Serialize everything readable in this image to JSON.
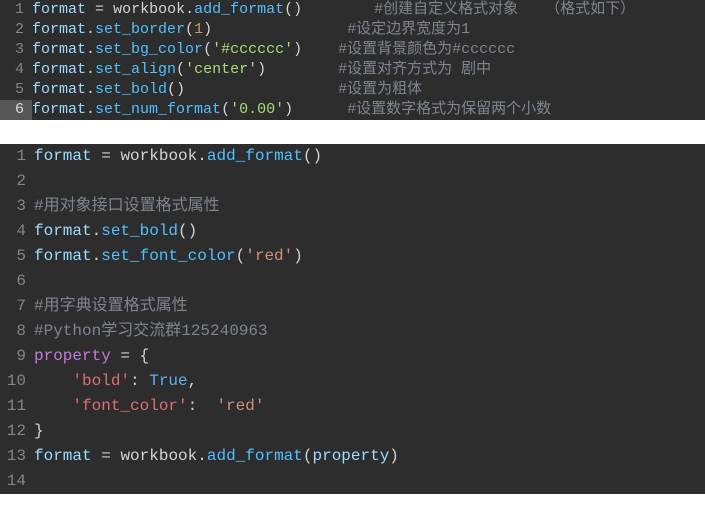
{
  "block1": {
    "lines": [
      {
        "num": "1",
        "tokens": [
          {
            "t": "format",
            "c": "tok-var"
          },
          {
            "t": " ",
            "c": ""
          },
          {
            "t": "=",
            "c": "tok-op"
          },
          {
            "t": " ",
            "c": ""
          },
          {
            "t": "workbook",
            "c": "tok-obj"
          },
          {
            "t": ".",
            "c": "tok-punct"
          },
          {
            "t": "add_format",
            "c": "tok-method"
          },
          {
            "t": "()",
            "c": "tok-punct"
          },
          {
            "t": "        ",
            "c": ""
          },
          {
            "t": "#创建自定义格式对象   （格式如下）",
            "c": "tok-comment"
          }
        ]
      },
      {
        "num": "2",
        "tokens": [
          {
            "t": "format",
            "c": "tok-var"
          },
          {
            "t": ".",
            "c": "tok-punct"
          },
          {
            "t": "set_border",
            "c": "tok-method"
          },
          {
            "t": "(",
            "c": "tok-punct"
          },
          {
            "t": "1",
            "c": "tok-num"
          },
          {
            "t": ")",
            "c": "tok-punct"
          },
          {
            "t": "               ",
            "c": ""
          },
          {
            "t": "#设定边界宽度为1",
            "c": "tok-comment"
          }
        ]
      },
      {
        "num": "3",
        "tokens": [
          {
            "t": "format",
            "c": "tok-var"
          },
          {
            "t": ".",
            "c": "tok-punct"
          },
          {
            "t": "set_bg_color",
            "c": "tok-method"
          },
          {
            "t": "(",
            "c": "tok-punct"
          },
          {
            "t": "'#cccccc'",
            "c": "tok-str2"
          },
          {
            "t": ")",
            "c": "tok-punct"
          },
          {
            "t": "    ",
            "c": ""
          },
          {
            "t": "#设置背景颜色为#cccccc",
            "c": "tok-comment"
          }
        ]
      },
      {
        "num": "4",
        "tokens": [
          {
            "t": "format",
            "c": "tok-var"
          },
          {
            "t": ".",
            "c": "tok-punct"
          },
          {
            "t": "set_align",
            "c": "tok-method"
          },
          {
            "t": "(",
            "c": "tok-punct"
          },
          {
            "t": "'center'",
            "c": "tok-str2"
          },
          {
            "t": ")",
            "c": "tok-punct"
          },
          {
            "t": "        ",
            "c": ""
          },
          {
            "t": "#设置对齐方式为 剧中",
            "c": "tok-comment"
          }
        ]
      },
      {
        "num": "5",
        "tokens": [
          {
            "t": "format",
            "c": "tok-var"
          },
          {
            "t": ".",
            "c": "tok-punct"
          },
          {
            "t": "set_bold",
            "c": "tok-method"
          },
          {
            "t": "()",
            "c": "tok-punct"
          },
          {
            "t": "                 ",
            "c": ""
          },
          {
            "t": "#设置为粗体",
            "c": "tok-comment"
          }
        ]
      },
      {
        "num": "6",
        "highlight": true,
        "tokens": [
          {
            "t": "format",
            "c": "tok-var"
          },
          {
            "t": ".",
            "c": "tok-punct"
          },
          {
            "t": "set_num_format",
            "c": "tok-method"
          },
          {
            "t": "(",
            "c": "tok-punct"
          },
          {
            "t": "'0.00'",
            "c": "tok-str2"
          },
          {
            "t": ")",
            "c": "tok-punct"
          },
          {
            "t": "      ",
            "c": ""
          },
          {
            "t": "#设置数字格式为保留两个小数",
            "c": "tok-comment"
          }
        ]
      }
    ]
  },
  "block2": {
    "lines": [
      {
        "num": "1",
        "tokens": [
          {
            "t": "format",
            "c": "tok-var"
          },
          {
            "t": " ",
            "c": ""
          },
          {
            "t": "=",
            "c": "tok-op"
          },
          {
            "t": " ",
            "c": ""
          },
          {
            "t": "workbook",
            "c": "tok-obj"
          },
          {
            "t": ".",
            "c": "tok-punct"
          },
          {
            "t": "add_format",
            "c": "tok-method"
          },
          {
            "t": "()",
            "c": "tok-punct"
          }
        ]
      },
      {
        "num": "2",
        "tokens": []
      },
      {
        "num": "3",
        "tokens": [
          {
            "t": "#用对象接口设置格式属性",
            "c": "tok-comment"
          }
        ]
      },
      {
        "num": "4",
        "tokens": [
          {
            "t": "format",
            "c": "tok-var"
          },
          {
            "t": ".",
            "c": "tok-punct"
          },
          {
            "t": "set_bold",
            "c": "tok-method"
          },
          {
            "t": "()",
            "c": "tok-punct"
          }
        ]
      },
      {
        "num": "5",
        "tokens": [
          {
            "t": "format",
            "c": "tok-var"
          },
          {
            "t": ".",
            "c": "tok-punct"
          },
          {
            "t": "set_font_color",
            "c": "tok-method"
          },
          {
            "t": "(",
            "c": "tok-punct"
          },
          {
            "t": "'red'",
            "c": "tok-str"
          },
          {
            "t": ")",
            "c": "tok-punct"
          }
        ]
      },
      {
        "num": "6",
        "tokens": []
      },
      {
        "num": "7",
        "tokens": [
          {
            "t": "#用字典设置格式属性",
            "c": "tok-comment"
          }
        ]
      },
      {
        "num": "8",
        "tokens": [
          {
            "t": "#Python学习交流群125240963",
            "c": "tok-comment"
          }
        ]
      },
      {
        "num": "9",
        "tokens": [
          {
            "t": "property",
            "c": "tok-key"
          },
          {
            "t": " ",
            "c": ""
          },
          {
            "t": "=",
            "c": "tok-op"
          },
          {
            "t": " {",
            "c": "tok-punct"
          }
        ]
      },
      {
        "num": "10",
        "tokens": [
          {
            "t": "    ",
            "c": ""
          },
          {
            "t": "'bold'",
            "c": "tok-prop"
          },
          {
            "t": ": ",
            "c": "tok-punct"
          },
          {
            "t": "True",
            "c": "tok-bool"
          },
          {
            "t": ",",
            "c": "tok-punct"
          }
        ]
      },
      {
        "num": "11",
        "tokens": [
          {
            "t": "    ",
            "c": ""
          },
          {
            "t": "'font_color'",
            "c": "tok-prop"
          },
          {
            "t": ":  ",
            "c": "tok-punct"
          },
          {
            "t": "'red'",
            "c": "tok-str"
          }
        ]
      },
      {
        "num": "12",
        "tokens": [
          {
            "t": "}",
            "c": "tok-punct"
          }
        ]
      },
      {
        "num": "13",
        "tokens": [
          {
            "t": "format",
            "c": "tok-var"
          },
          {
            "t": " ",
            "c": ""
          },
          {
            "t": "=",
            "c": "tok-op"
          },
          {
            "t": " ",
            "c": ""
          },
          {
            "t": "workbook",
            "c": "tok-obj"
          },
          {
            "t": ".",
            "c": "tok-punct"
          },
          {
            "t": "add_format",
            "c": "tok-method"
          },
          {
            "t": "(",
            "c": "tok-punct"
          },
          {
            "t": "property",
            "c": "tok-var"
          },
          {
            "t": ")",
            "c": "tok-punct"
          }
        ]
      },
      {
        "num": "14",
        "tokens": []
      }
    ]
  }
}
